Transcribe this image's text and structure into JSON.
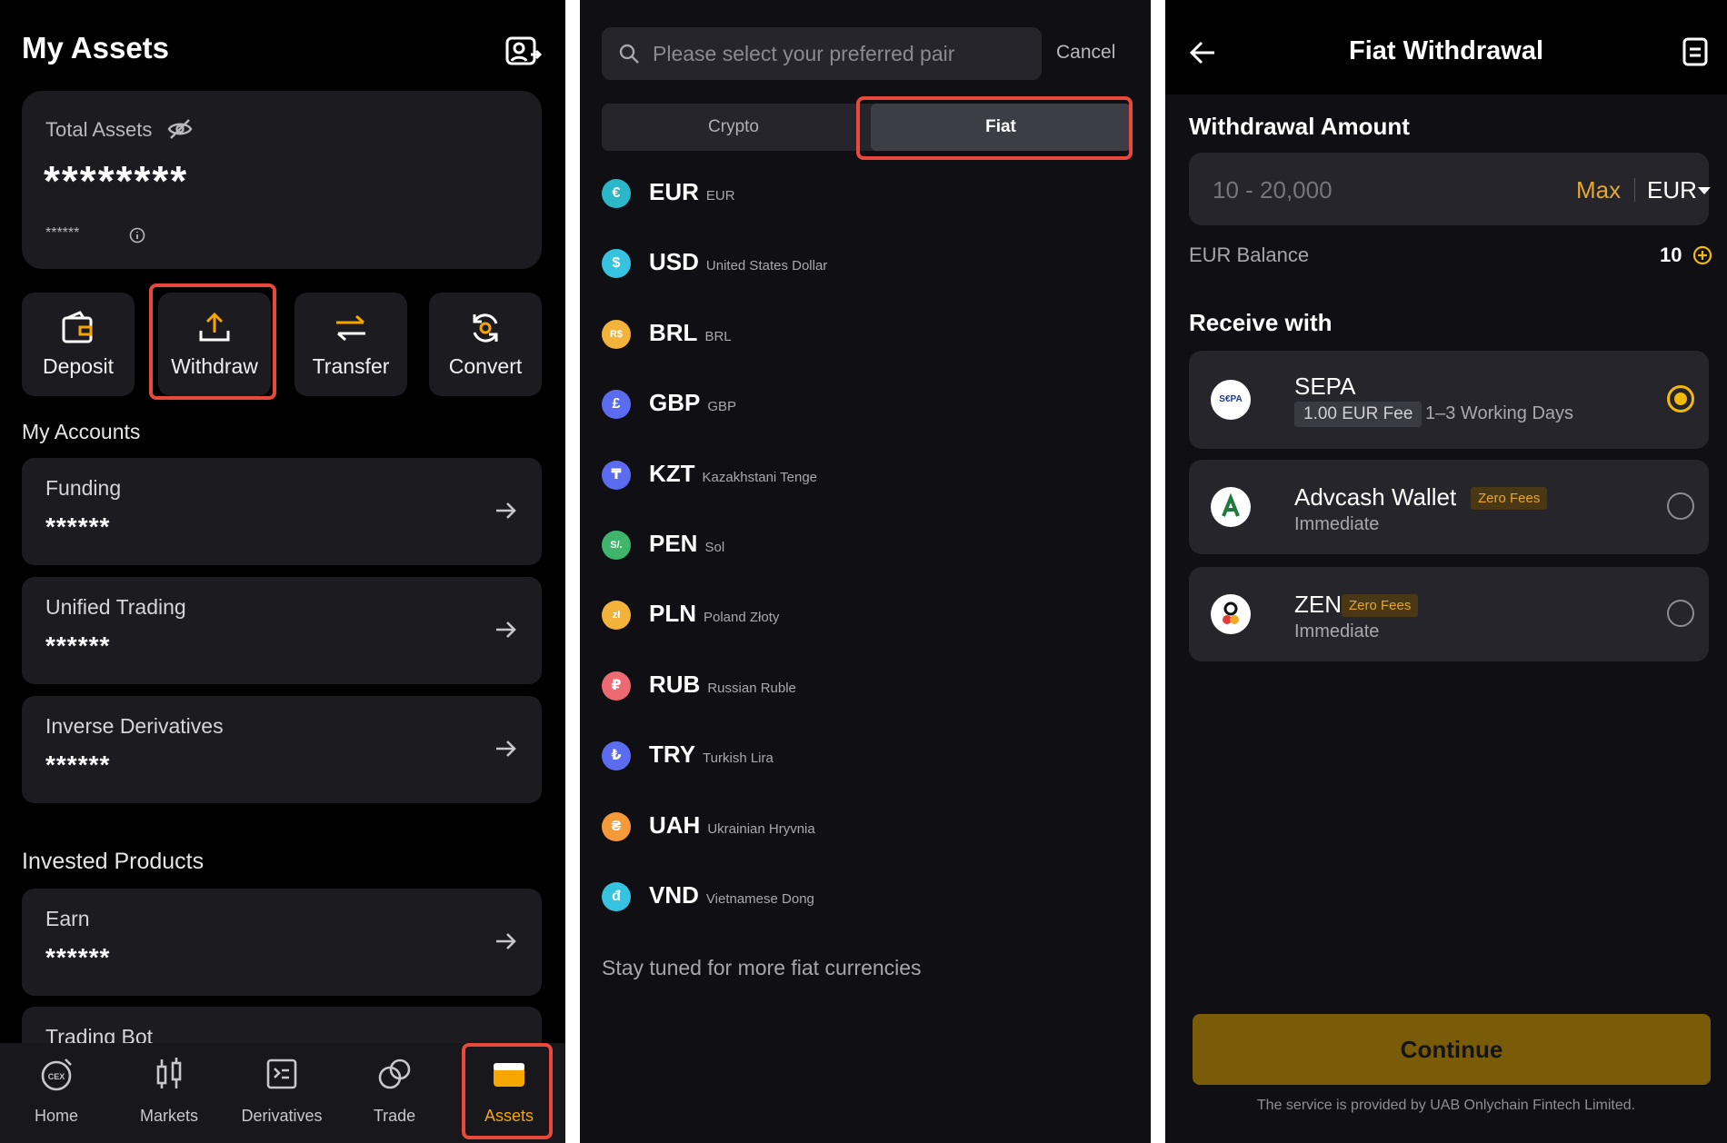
{
  "assets": {
    "title": "My Assets",
    "total_label": "Total Assets",
    "total_value": "********",
    "total_sub": "******",
    "actions": [
      {
        "label": "Deposit"
      },
      {
        "label": "Withdraw"
      },
      {
        "label": "Transfer"
      },
      {
        "label": "Convert"
      }
    ],
    "accounts_title": "My Accounts",
    "accounts": [
      {
        "name": "Funding",
        "value": "******"
      },
      {
        "name": "Unified Trading",
        "value": "******"
      },
      {
        "name": "Inverse Derivatives",
        "value": "******"
      }
    ],
    "invested_title": "Invested Products",
    "invested": [
      {
        "name": "Earn",
        "value": "******"
      },
      {
        "name": "Trading Bot",
        "value": ""
      }
    ],
    "nav": [
      {
        "label": "Home",
        "icon": "cex-home-icon"
      },
      {
        "label": "Markets",
        "icon": "candlestick-icon"
      },
      {
        "label": "Derivatives",
        "icon": "derivatives-icon"
      },
      {
        "label": "Trade",
        "icon": "trade-icon"
      },
      {
        "label": "Assets",
        "icon": "wallet-icon",
        "active": true
      }
    ],
    "accent_color": "#f7a600"
  },
  "pair_select": {
    "search_placeholder": "Please select your preferred pair",
    "cancel_label": "Cancel",
    "tabs": [
      {
        "label": "Crypto",
        "active": false
      },
      {
        "label": "Fiat",
        "active": true
      }
    ],
    "currencies": [
      {
        "code": "EUR",
        "name": "EUR",
        "symbol": "€",
        "color": "#2ab8c8"
      },
      {
        "code": "USD",
        "name": "United States Dollar",
        "symbol": "$",
        "color": "#36c3df"
      },
      {
        "code": "BRL",
        "name": "BRL",
        "symbol": "R$",
        "color": "#f3b23a"
      },
      {
        "code": "GBP",
        "name": "GBP",
        "symbol": "£",
        "color": "#5b6cf0"
      },
      {
        "code": "KZT",
        "name": "Kazakhstani Tenge",
        "symbol": "₸",
        "color": "#5b6cf0"
      },
      {
        "code": "PEN",
        "name": "Sol",
        "symbol": "S/.",
        "color": "#3fb56c"
      },
      {
        "code": "PLN",
        "name": "Poland Złoty",
        "symbol": "zł",
        "color": "#f3b23a"
      },
      {
        "code": "RUB",
        "name": "Russian Ruble",
        "symbol": "₽",
        "color": "#ec6a72"
      },
      {
        "code": "TRY",
        "name": "Turkish Lira",
        "symbol": "₺",
        "color": "#5b6cf0"
      },
      {
        "code": "UAH",
        "name": "Ukrainian Hryvnia",
        "symbol": "₴",
        "color": "#f59a3a"
      },
      {
        "code": "VND",
        "name": "Vietnamese Dong",
        "symbol": "đ",
        "color": "#36c3df"
      }
    ],
    "footer_text": "Stay tuned for more fiat currencies"
  },
  "withdrawal": {
    "title": "Fiat Withdrawal",
    "amount_label": "Withdrawal Amount",
    "amount_placeholder": "10 - 20,000",
    "max_label": "Max",
    "currency": "EUR",
    "balance_label": "EUR Balance",
    "balance_value": "10",
    "receive_label": "Receive with",
    "methods": [
      {
        "name": "SEPA",
        "fee": "1.00 EUR Fee",
        "sub": "1–3 Working Days",
        "selected": true,
        "logo": "sepa-logo-icon",
        "logo_text": "S€PA"
      },
      {
        "name": "Advcash Wallet",
        "badge": "Zero Fees",
        "sub": "Immediate",
        "selected": false,
        "logo": "advcash-logo-icon"
      },
      {
        "name": "ZEN",
        "badge": "Zero Fees",
        "sub": "Immediate",
        "selected": false,
        "logo": "zen-logo-icon"
      }
    ],
    "continue_label": "Continue",
    "footnote": "The service is provided by UAB Onlychain Fintech Limited."
  }
}
